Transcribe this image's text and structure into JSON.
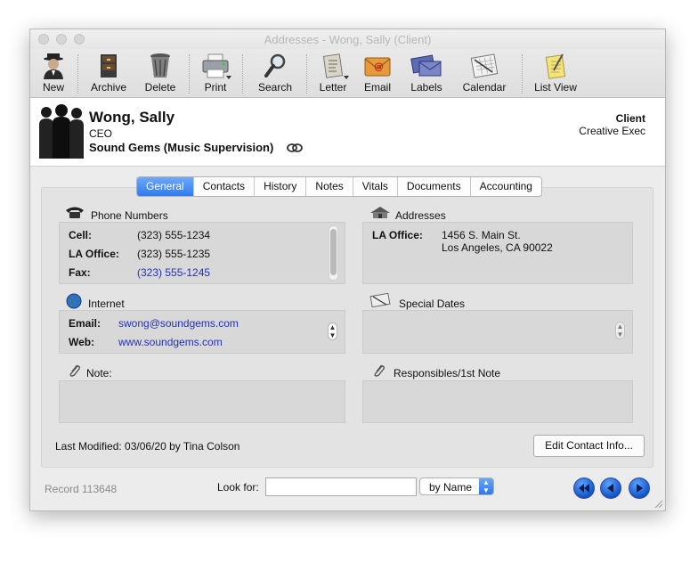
{
  "window": {
    "title": "Addresses - Wong, Sally (Client)"
  },
  "toolbar": {
    "new": "New",
    "archive": "Archive",
    "delete": "Delete",
    "print": "Print",
    "search": "Search",
    "letter": "Letter",
    "email": "Email",
    "labels": "Labels",
    "calendar": "Calendar",
    "list_view": "List View"
  },
  "contact": {
    "name": "Wong, Sally",
    "job_title": "CEO",
    "company": "Sound Gems (Music Supervision)",
    "type": "Client",
    "subtype": "Creative Exec"
  },
  "tabs": [
    "General",
    "Contacts",
    "History",
    "Notes",
    "Vitals",
    "Documents",
    "Accounting"
  ],
  "phone": {
    "title": "Phone Numbers",
    "rows": [
      {
        "label": "Cell:",
        "value": "(323) 555-1234"
      },
      {
        "label": "LA Office:",
        "value": "(323) 555-1235"
      },
      {
        "label": "Fax:",
        "value": "(323) 555-1245"
      }
    ]
  },
  "addresses": {
    "title": "Addresses",
    "label": "LA Office:",
    "line1": "1456 S. Main St.",
    "line2": "Los Angeles, CA 90022"
  },
  "internet": {
    "title": "Internet",
    "email_label": "Email:",
    "email": "swong@soundgems.com",
    "web_label": "Web:",
    "web": "www.soundgems.com"
  },
  "special_dates": {
    "title": "Special Dates"
  },
  "note": {
    "title": "Note:"
  },
  "responsibles": {
    "title": "Responsibles/1st Note"
  },
  "footer": {
    "last_modified": "Last Modified: 03/06/20 by Tina Colson",
    "edit_button": "Edit Contact Info...",
    "record": "Record 113648",
    "look_for": "Look for:",
    "look_value": "",
    "sort": "by Name"
  },
  "colors": {
    "tab_active": "#2f7bef",
    "link": "#2530b8",
    "nav_button": "#1553c9"
  }
}
